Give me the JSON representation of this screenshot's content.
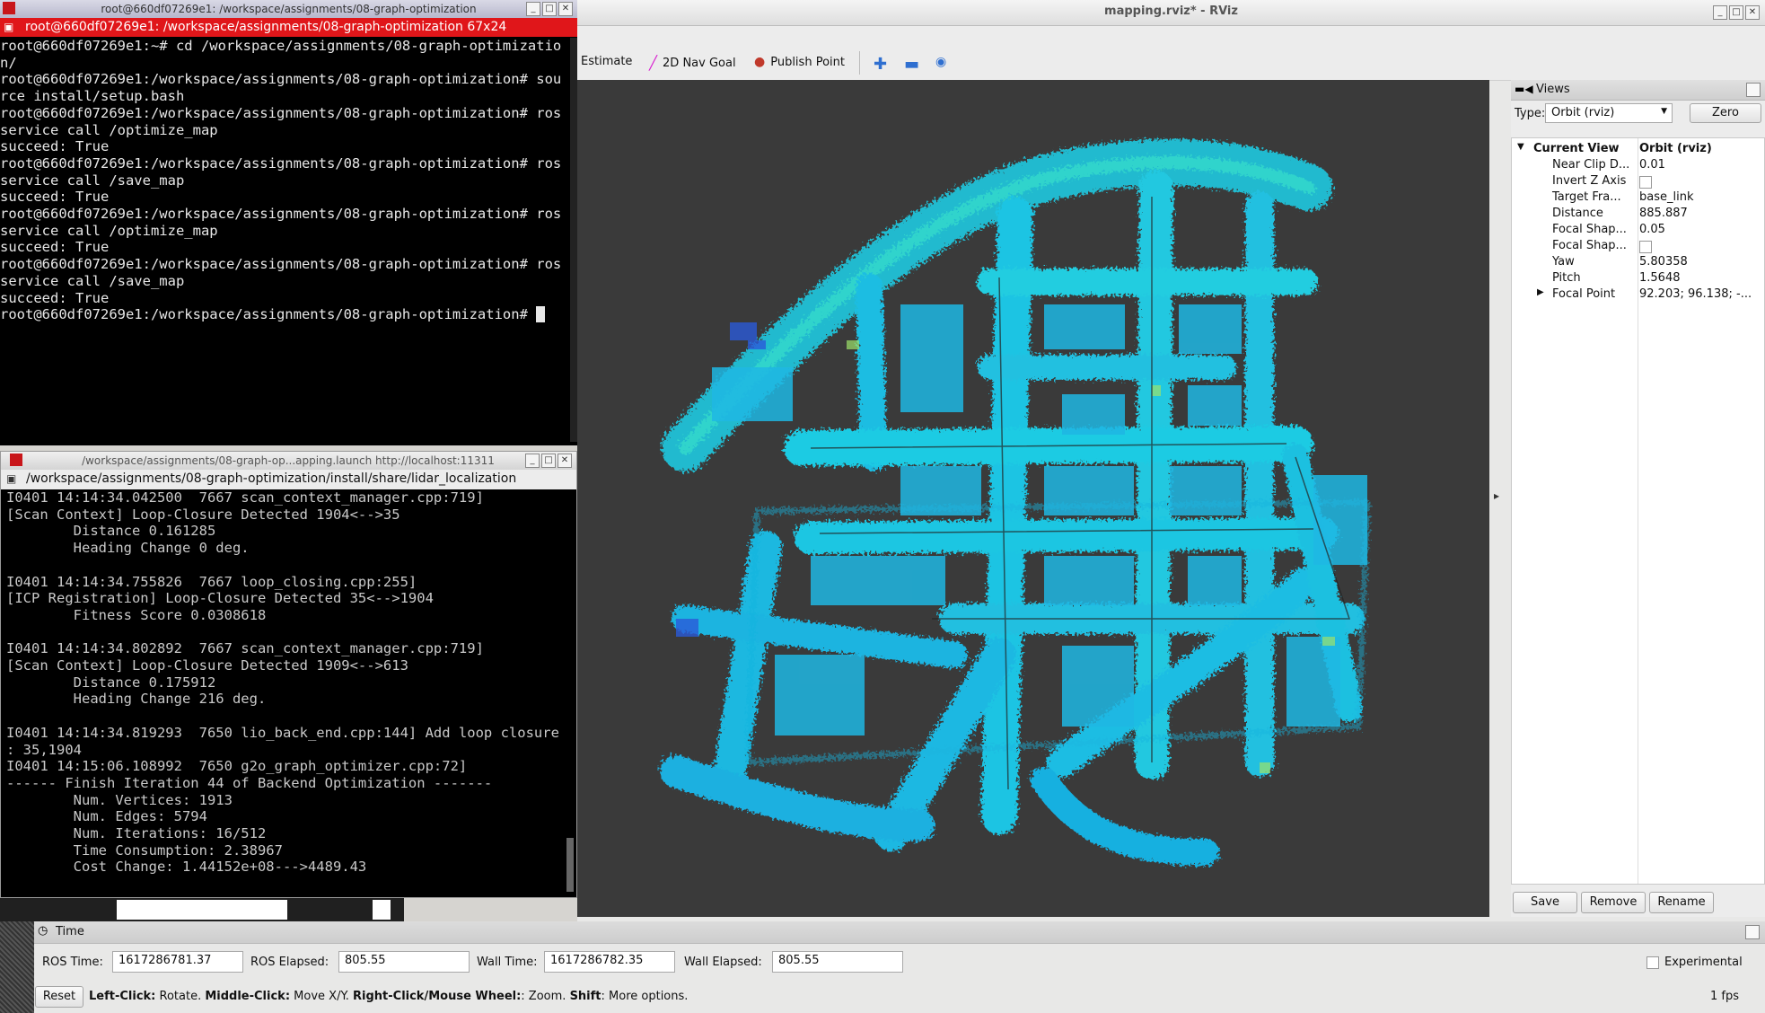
{
  "rviz": {
    "title": "mapping.rviz* - RViz",
    "toolbar": [
      {
        "label": "Estimate",
        "icon": ""
      },
      {
        "label": "2D Nav Goal",
        "icon": "pen-icon"
      },
      {
        "label": "Publish Point",
        "icon": "map-pin-icon"
      }
    ],
    "views": {
      "title": "Views",
      "type_label": "Type:",
      "type_value": "Orbit (rviz)",
      "zero_label": "Zero",
      "current_view": {
        "name": "Current View",
        "value": "Orbit (rviz)"
      },
      "properties": [
        {
          "name": "Near Clip D...",
          "value": "0.01"
        },
        {
          "name": "Invert Z Axis",
          "value": ""
        },
        {
          "name": "Target Fra...",
          "value": "base_link"
        },
        {
          "name": "Distance",
          "value": "885.887"
        },
        {
          "name": "Focal Shap...",
          "value": "0.05"
        },
        {
          "name": "Focal Shap...",
          "value": ""
        },
        {
          "name": "Yaw",
          "value": "5.80358"
        },
        {
          "name": "Pitch",
          "value": "1.5648"
        },
        {
          "name": "Focal Point",
          "value": "92.203; 96.138; -..."
        }
      ],
      "save_label": "Save",
      "remove_label": "Remove",
      "rename_label": "Rename"
    },
    "time": {
      "title": "Time",
      "ros_time_label": "ROS Time:",
      "ros_time": "1617286781.37",
      "ros_elapsed_label": "ROS Elapsed:",
      "ros_elapsed": "805.55",
      "wall_time_label": "Wall Time:",
      "wall_time": "1617286782.35",
      "wall_elapsed_label": "Wall Elapsed:",
      "wall_elapsed": "805.55",
      "experimental_label": "Experimental",
      "reset_label": "Reset",
      "hint_parts": [
        {
          "b": "Left-Click:",
          "t": " Rotate. "
        },
        {
          "b": "Middle-Click:",
          "t": " Move X/Y. "
        },
        {
          "b": "Right-Click/Mouse Wheel:",
          "t": ": Zoom. "
        },
        {
          "b": "Shift",
          "t": ": More options."
        }
      ],
      "fps": "1 fps"
    }
  },
  "terminal1": {
    "title": "root@660df07269e1: /workspace/assignments/08-graph-optimization",
    "tab": "root@660df07269e1: /workspace/assignments/08-graph-optimization 67x24",
    "lines": [
      "root@660df07269e1:~# cd /workspace/assignments/08-graph-optimizatio",
      "n/",
      "root@660df07269e1:/workspace/assignments/08-graph-optimization# sou",
      "rce install/setup.bash",
      "root@660df07269e1:/workspace/assignments/08-graph-optimization# ros",
      "service call /optimize_map",
      "succeed: True",
      "root@660df07269e1:/workspace/assignments/08-graph-optimization# ros",
      "service call /save_map",
      "succeed: True",
      "root@660df07269e1:/workspace/assignments/08-graph-optimization# ros",
      "service call /optimize_map",
      "succeed: True",
      "root@660df07269e1:/workspace/assignments/08-graph-optimization# ros",
      "service call /save_map",
      "succeed: True",
      "root@660df07269e1:/workspace/assignments/08-graph-optimization# "
    ]
  },
  "terminal2": {
    "title": "/workspace/assignments/08-graph-op...apping.launch http://localhost:11311",
    "tab": "/workspace/assignments/08-graph-optimization/install/share/lidar_localization",
    "lines": [
      "I0401 14:14:34.042500  7667 scan_context_manager.cpp:719]",
      "[Scan Context] Loop-Closure Detected 1904<-->35",
      "        Distance 0.161285",
      "        Heading Change 0 deg.",
      "",
      "I0401 14:14:34.755826  7667 loop_closing.cpp:255]",
      "[ICP Registration] Loop-Closure Detected 35<-->1904",
      "        Fitness Score 0.0308618",
      "",
      "I0401 14:14:34.802892  7667 scan_context_manager.cpp:719]",
      "[Scan Context] Loop-Closure Detected 1909<-->613",
      "        Distance 0.175912",
      "        Heading Change 216 deg.",
      "",
      "I0401 14:14:34.819293  7650 lio_back_end.cpp:144] Add loop closure",
      ": 35,1904",
      "I0401 14:15:06.108992  7650 g2o_graph_optimizer.cpp:72]",
      "------ Finish Iteration 44 of Backend Optimization -------",
      "        Num. Vertices: 1913",
      "        Num. Edges: 5794",
      "        Num. Iterations: 16/512",
      "        Time Consumption: 2.38967",
      "        Cost Change: 1.44152e+08--->4489.43"
    ]
  }
}
